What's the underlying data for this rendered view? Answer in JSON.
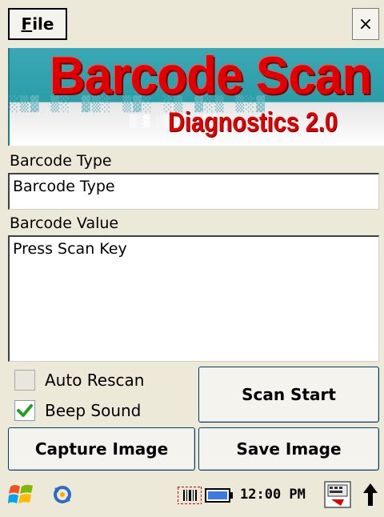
{
  "menu": {
    "file_label": "File",
    "file_accel": "F",
    "file_rest": "ile",
    "close_label": "×"
  },
  "banner": {
    "title": "Barcode Scan",
    "subtitle": "Diagnostics 2.0"
  },
  "form": {
    "barcode_type_label": "Barcode Type",
    "barcode_type_value": "Barcode Type",
    "barcode_value_label": "Barcode Value",
    "barcode_value_text": "Press Scan Key"
  },
  "options": {
    "auto_rescan_label": "Auto Rescan",
    "auto_rescan_checked": false,
    "beep_sound_label": "Beep Sound",
    "beep_sound_checked": true
  },
  "buttons": {
    "scan_start": "Scan Start",
    "capture_image": "Capture Image",
    "save_image": "Save Image"
  },
  "taskbar": {
    "clock": "12:00 PM",
    "icons": [
      "windows-logo-icon",
      "sync-icon",
      "barcode-icon",
      "battery-icon",
      "keyboard-icon",
      "arrow-up-icon"
    ]
  },
  "colors": {
    "title_red": "#e00000",
    "banner_teal": "#2a9ea8",
    "check_green": "#21a121",
    "button_border": "#003c74"
  }
}
